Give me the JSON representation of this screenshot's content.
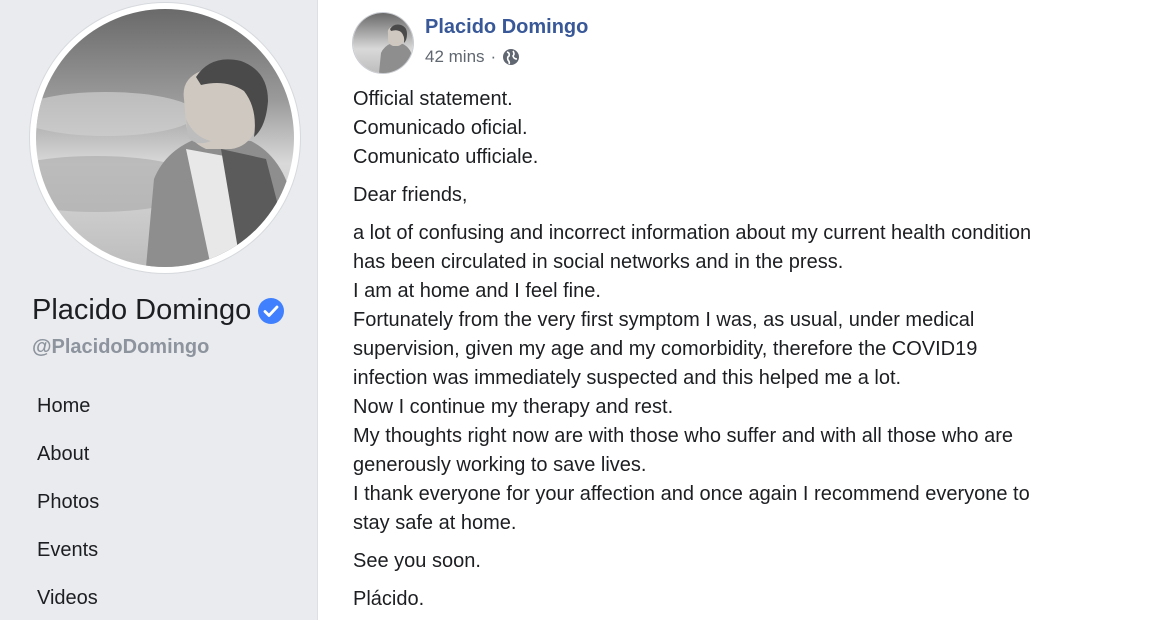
{
  "sidebar": {
    "page_name": "Placido Domingo",
    "handle": "@PlacidoDomingo",
    "nav": [
      "Home",
      "About",
      "Photos",
      "Events",
      "Videos"
    ]
  },
  "post": {
    "author": "Placido Domingo",
    "time": "42 mins",
    "separator": "·",
    "privacy_icon": "globe-icon",
    "paragraphs": [
      [
        "Official statement.",
        "Comunicado oficial.",
        "Comunicato ufficiale."
      ],
      [
        "Dear friends,"
      ],
      [
        "a lot of confusing and incorrect information about my current health condition",
        "has been circulated in social networks and in the press.",
        "I am at home and I feel fine.",
        "Fortunately from the very first symptom I was, as usual, under medical",
        "supervision, given my age and my comorbidity, therefore the COVID19",
        "infection was immediately suspected and this helped me a lot.",
        "Now I continue my therapy and rest.",
        "My thoughts right now are with those who suffer and with all those who are",
        "generously working to save lives.",
        "I thank everyone for your affection and once again I recommend everyone to",
        "stay safe at home."
      ],
      [
        "See you soon."
      ],
      [
        "Plácido."
      ]
    ]
  },
  "colors": {
    "sidebar_bg": "#e9ebee",
    "link_blue": "#385898",
    "verified_blue": "#4080ff",
    "muted_gray": "#8d949e"
  }
}
